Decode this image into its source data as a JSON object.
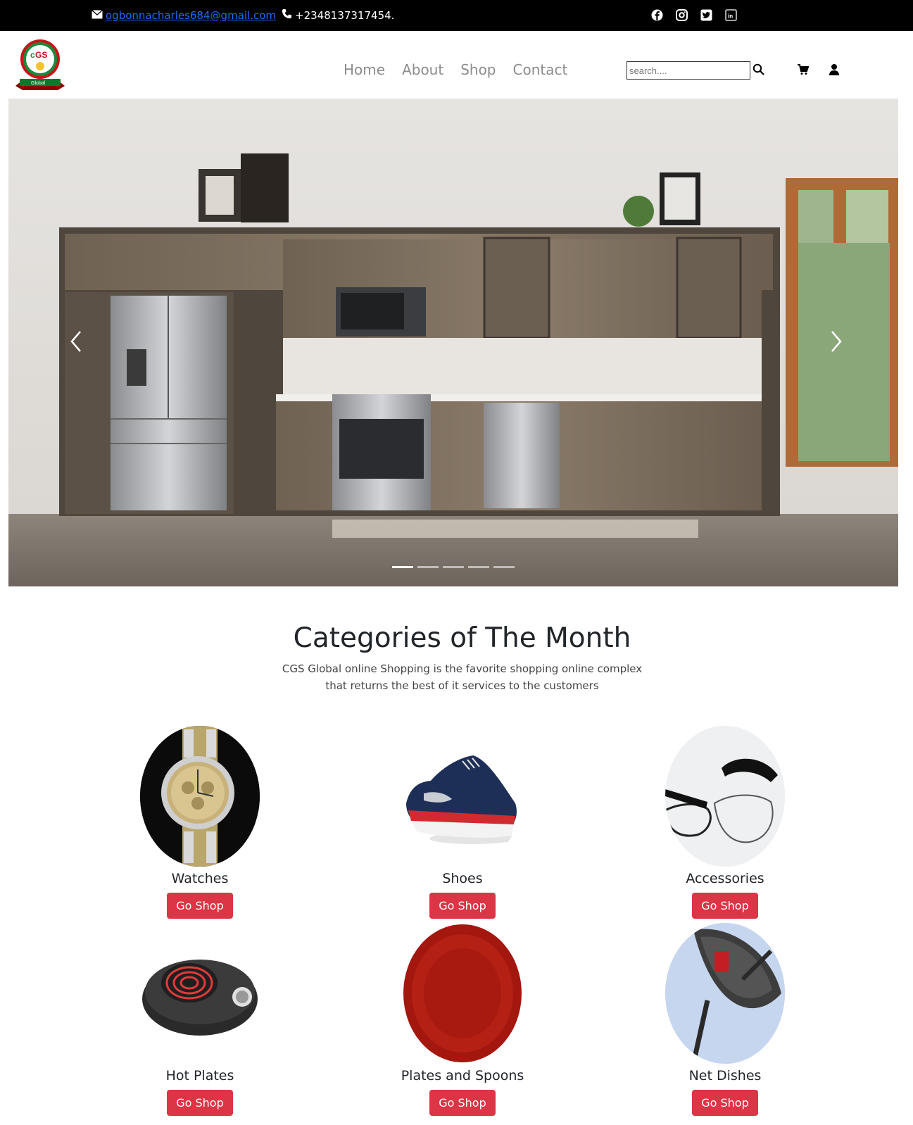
{
  "topbar": {
    "email": "ogbonnacharles684@gmail.com",
    "phone": "+2348137317454.",
    "socials": [
      "facebook-icon",
      "instagram-icon",
      "twitter-icon",
      "linkedin-icon"
    ]
  },
  "navbar": {
    "logo_text": "CGS",
    "logo_sub": "Global",
    "links": [
      "Home",
      "About",
      "Shop",
      "Contact"
    ],
    "search_placeholder": "search...."
  },
  "carousel": {
    "slide_count": 5,
    "active_index": 0
  },
  "categories": {
    "title": "Categories of The Month",
    "subtitle_line1": "CGS Global online Shopping is the favorite shopping online complex",
    "subtitle_line2": "that returns the best of it services to the customers",
    "items": [
      {
        "name": "Watches",
        "button": "Go Shop"
      },
      {
        "name": "Shoes",
        "button": "Go Shop"
      },
      {
        "name": "Accessories",
        "button": "Go Shop"
      },
      {
        "name": "Hot Plates",
        "button": "Go Shop"
      },
      {
        "name": "Plates and Spoons",
        "button": "Go Shop"
      },
      {
        "name": "Net Dishes",
        "button": "Go Shop"
      }
    ]
  },
  "colors": {
    "topbar_bg": "#000000",
    "button_red": "#dc3545",
    "link_blue": "#1e6bff",
    "nav_gray": "#8c8c8c"
  }
}
